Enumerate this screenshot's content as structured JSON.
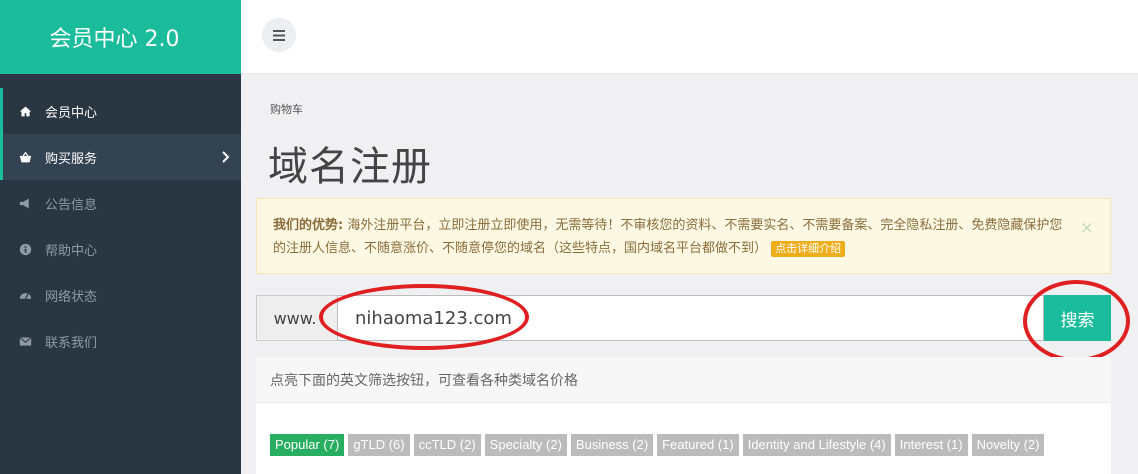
{
  "sidebar": {
    "brand": "会员中心 2.0",
    "items": [
      {
        "label": "会员中心",
        "icon": "home-icon"
      },
      {
        "label": "购买服务",
        "icon": "basket-icon"
      },
      {
        "label": "公告信息",
        "icon": "megaphone-icon"
      },
      {
        "label": "帮助中心",
        "icon": "info-icon"
      },
      {
        "label": "网络状态",
        "icon": "dashboard-icon"
      },
      {
        "label": "联系我们",
        "icon": "envelope-icon"
      }
    ]
  },
  "topbar": {
    "menu_icon": "hamburger-icon"
  },
  "breadcrumb": "购物车",
  "page_title": "域名注册",
  "alert": {
    "heading": "我们的优势:",
    "text": "海外注册平台，立即注册立即使用，无需等待！不审核您的资料、不需要实名、不需要备案、完全隐私注册、免费隐藏保护您的注册人信息、不随意涨价、不随意停您的域名（这些特点，国内域名平台都做不到）",
    "badge": "点击详细介绍",
    "close": "×"
  },
  "search": {
    "prefix": "www.",
    "value": "nihaoma123.com",
    "button": "搜索"
  },
  "filter": {
    "hint": "点亮下面的英文筛选按钮，可查看各种类域名价格",
    "tags": [
      {
        "label": "Popular (7)",
        "active": true
      },
      {
        "label": "gTLD (6)",
        "active": false
      },
      {
        "label": "ccTLD (2)",
        "active": false
      },
      {
        "label": "Specialty (2)",
        "active": false
      },
      {
        "label": "Business (2)",
        "active": false
      },
      {
        "label": "Featured (1)",
        "active": false
      },
      {
        "label": "Identity and Lifestyle (4)",
        "active": false
      },
      {
        "label": "Interest (1)",
        "active": false
      },
      {
        "label": "Novelty (2)",
        "active": false
      }
    ]
  },
  "colors": {
    "accent": "#1abc9c",
    "sidebar": "#2b3643",
    "annotation": "#e02020",
    "tag_active": "#27ae60"
  }
}
